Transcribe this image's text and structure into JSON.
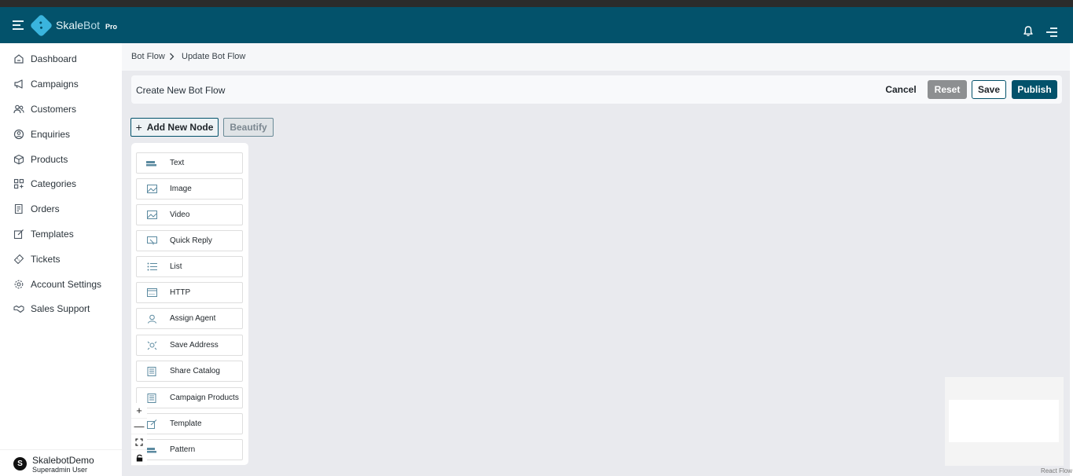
{
  "app": {
    "name": "SkaleBot",
    "name_prefix": "Skale",
    "name_suffix": "Bot",
    "tier": "Pro"
  },
  "topbar": {
    "menu_icon": "hamburger-icon",
    "notifications_icon": "bell-icon",
    "right_menu_icon": "menu-icon"
  },
  "sidebar": {
    "items": [
      {
        "label": "Dashboard",
        "icon": "dashboard-icon"
      },
      {
        "label": "Campaigns",
        "icon": "megaphone-icon"
      },
      {
        "label": "Customers",
        "icon": "users-icon"
      },
      {
        "label": "Enquiries",
        "icon": "user-circle-icon"
      },
      {
        "label": "Products",
        "icon": "box-icon"
      },
      {
        "label": "Categories",
        "icon": "grid-icon"
      },
      {
        "label": "Orders",
        "icon": "receipt-icon"
      },
      {
        "label": "Templates",
        "icon": "template-icon"
      },
      {
        "label": "Tickets",
        "icon": "ticket-icon"
      },
      {
        "label": "Account Settings",
        "icon": "gear-icon"
      },
      {
        "label": "Sales Support",
        "icon": "handshake-icon"
      }
    ],
    "user": {
      "initial": "S",
      "name": "SkalebotDemo",
      "role": "Superadmin User"
    }
  },
  "breadcrumb": {
    "items": [
      "Bot Flow",
      "Update Bot Flow"
    ]
  },
  "header": {
    "title": "Create New Bot Flow",
    "cancel_label": "Cancel",
    "reset_label": "Reset",
    "save_label": "Save",
    "publish_label": "Publish"
  },
  "toolbar": {
    "add_node_label": "Add New Node",
    "beautify_label": "Beautify"
  },
  "nodes": [
    {
      "label": "Text",
      "icon": "text-icon"
    },
    {
      "label": "Image",
      "icon": "image-icon"
    },
    {
      "label": "Video",
      "icon": "video-icon"
    },
    {
      "label": "Quick Reply",
      "icon": "quick-reply-icon"
    },
    {
      "label": "List",
      "icon": "list-icon"
    },
    {
      "label": "HTTP",
      "icon": "http-icon"
    },
    {
      "label": "Assign Agent",
      "icon": "agent-icon"
    },
    {
      "label": "Save Address",
      "icon": "address-icon"
    },
    {
      "label": "Share Catalog",
      "icon": "catalog-icon"
    },
    {
      "label": "Campaign Products",
      "icon": "campaign-products-icon"
    },
    {
      "label": "Template",
      "icon": "template-node-icon"
    },
    {
      "label": "Pattern",
      "icon": "pattern-icon"
    }
  ],
  "canvas_controls": {
    "zoom_in": "+",
    "zoom_out": "—",
    "fit_icon": "fit-view-icon",
    "lock_icon": "lock-icon"
  },
  "attribution": "React Flow",
  "colors": {
    "brand": "#03526b",
    "accent": "#3ab4dd",
    "canvas": "#e9eaee",
    "reset": "#8d8f91"
  }
}
